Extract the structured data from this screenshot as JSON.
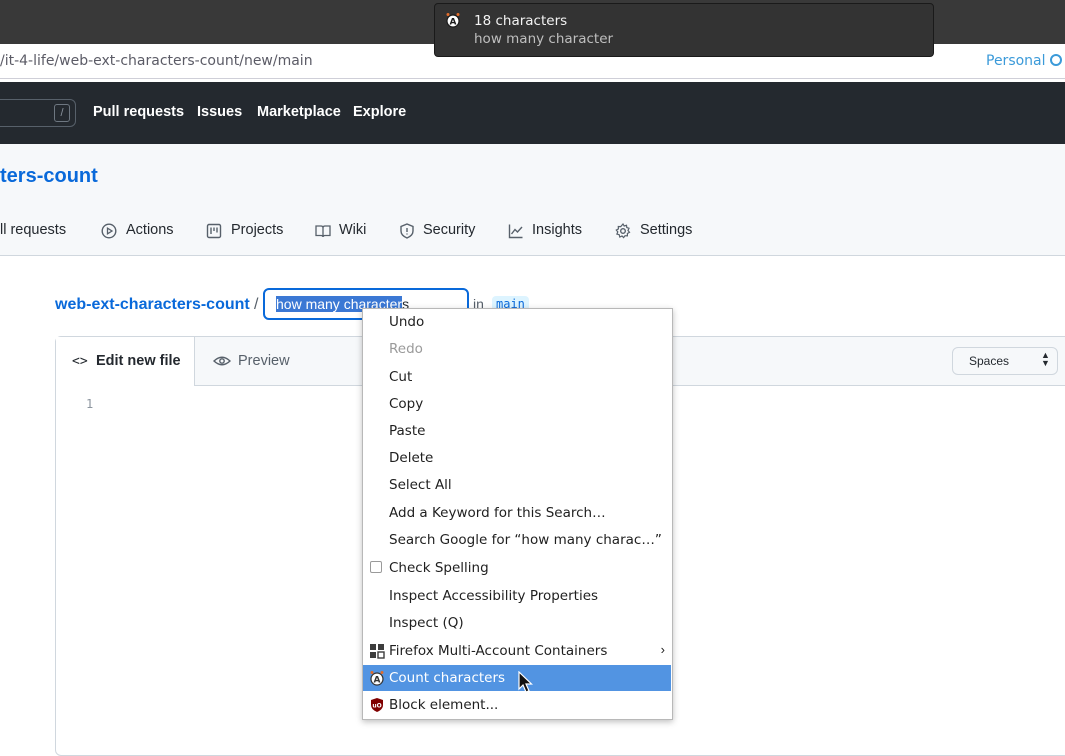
{
  "browser": {
    "url": "/it-4-life/web-ext-characters-count/new/main",
    "container_label": "Personal"
  },
  "notification": {
    "title": "18 characters",
    "body": "how many character"
  },
  "github_nav": {
    "search_key": "/",
    "items": [
      "Pull requests",
      "Issues",
      "Marketplace",
      "Explore"
    ]
  },
  "repo": {
    "name_fragment": "ters-count",
    "tabs": [
      "ll requests",
      "Actions",
      "Projects",
      "Wiki",
      "Security",
      "Insights",
      "Settings"
    ]
  },
  "file_row": {
    "repo_link": "web-ext-characters-count",
    "separator": "/",
    "filename_selected": "how many character",
    "filename_rest": "s",
    "in_label": "in",
    "branch": "main"
  },
  "editor": {
    "tab_edit": "Edit new file",
    "tab_preview": "Preview",
    "indent_mode": "Spaces",
    "line_number": "1"
  },
  "context_menu": {
    "items": [
      "Undo",
      "Redo",
      "Cut",
      "Copy",
      "Paste",
      "Delete",
      "Select All",
      "Add a Keyword for this Search…",
      "Search Google for “how many charac…”",
      "Check Spelling",
      "Inspect Accessibility Properties",
      "Inspect (Q)",
      "Firefox Multi-Account Containers",
      "Count characters",
      "Block element..."
    ],
    "highlight_color": "#5294e2"
  },
  "colors": {
    "github_header": "#24292f",
    "link_blue": "#0969da"
  }
}
